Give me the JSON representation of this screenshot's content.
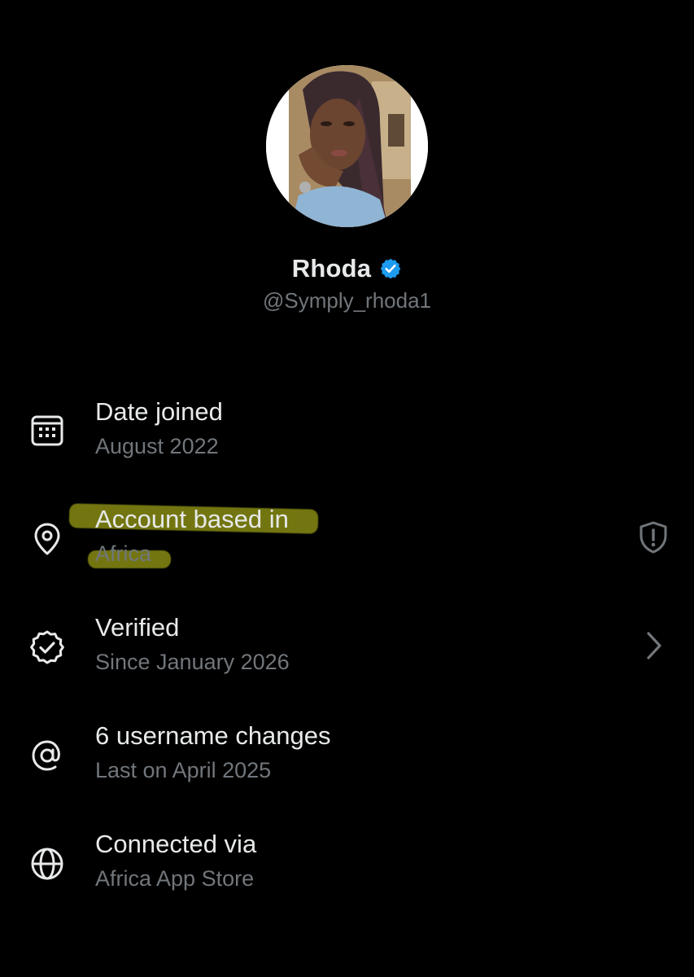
{
  "profile": {
    "display_name": "Rhoda",
    "handle": "@Symply_rhoda1",
    "verified_badge_icon": "verified-badge-icon",
    "badge_color": "#1d9bf0"
  },
  "info": {
    "date_joined": {
      "title": "Date joined",
      "value": "August 2022",
      "icon": "calendar-icon"
    },
    "account_based": {
      "title": "Account based in",
      "value": "Africa",
      "icon": "location-pin-icon",
      "right_icon": "shield-alert-icon",
      "highlight_color": "#d2d71e"
    },
    "verified": {
      "title": "Verified",
      "value": "Since January 2026",
      "icon": "verified-check-icon",
      "right_icon": "chevron-right-icon"
    },
    "username_changes": {
      "title": "6 username changes",
      "value": "Last on April 2025",
      "icon": "at-sign-icon"
    },
    "connected_via": {
      "title": "Connected via",
      "value": "Africa App Store",
      "icon": "globe-icon"
    }
  },
  "colors": {
    "background": "#000000",
    "primary_text": "#e7e9ea",
    "secondary_text": "#71767b"
  }
}
